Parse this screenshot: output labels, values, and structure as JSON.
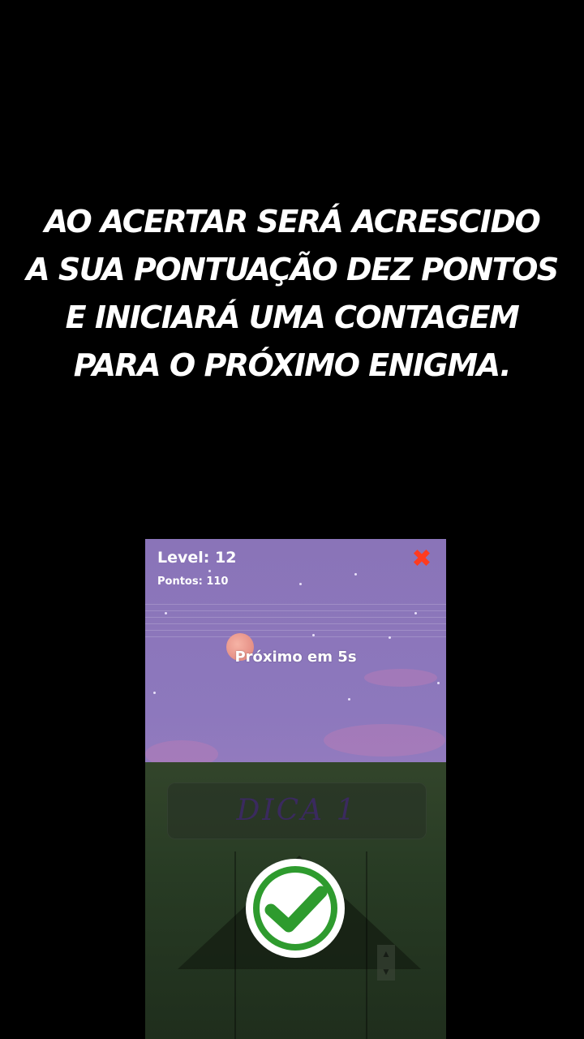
{
  "caption": {
    "lines": [
      "AO ACERTAR SERÁ ACRESCIDO",
      "A SUA PONTUAÇÃO DEZ PONTOS",
      "E INICIARÁ UMA CONTAGEM",
      "PARA O PRÓXIMO ENIGMA."
    ]
  },
  "game": {
    "level_label": "Level: 12",
    "points_label": "Pontos: 110",
    "next_label": "Próximo em 5s",
    "hint_label": "DICA 1",
    "close_icon": "close-icon",
    "success_icon": "checkmark-icon"
  },
  "colors": {
    "close": "#ff3b1f",
    "check_green": "#2e9b2e",
    "sky": "#8a74b8"
  }
}
